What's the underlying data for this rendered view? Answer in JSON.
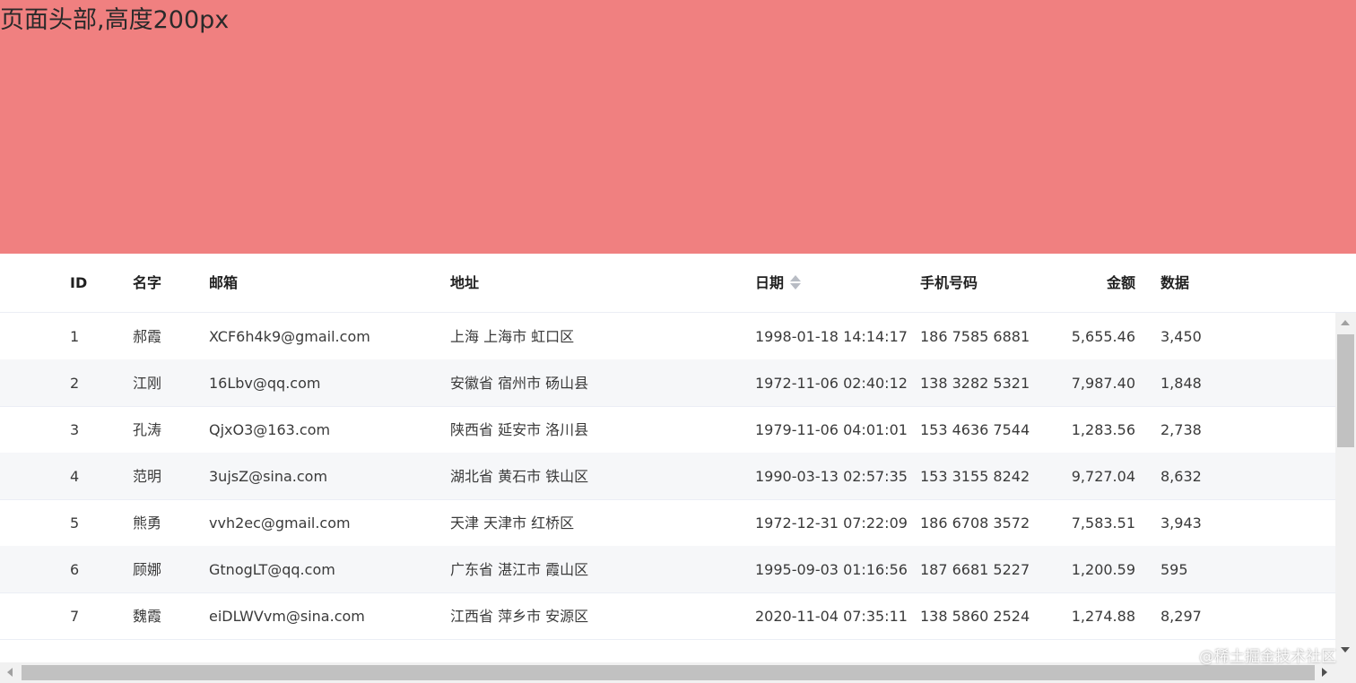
{
  "header": {
    "title": "页面头部,高度200px",
    "background": "#f08080"
  },
  "table": {
    "columns": {
      "id": "ID",
      "name": "名字",
      "email": "邮箱",
      "address": "地址",
      "date": "日期",
      "phone": "手机号码",
      "amount": "金额",
      "data": "数据"
    },
    "rows": [
      {
        "id": "1",
        "name": "郝霞",
        "email": "XCF6h4k9@gmail.com",
        "address": "上海 上海市 虹口区",
        "date": "1998-01-18 14:14:17",
        "phone": "186 7585 6881",
        "amount": "5,655.46",
        "data": "3,450"
      },
      {
        "id": "2",
        "name": "江刚",
        "email": "16Lbv@qq.com",
        "address": "安徽省 宿州市 砀山县",
        "date": "1972-11-06 02:40:12",
        "phone": "138 3282 5321",
        "amount": "7,987.40",
        "data": "1,848"
      },
      {
        "id": "3",
        "name": "孔涛",
        "email": "QjxO3@163.com",
        "address": "陕西省 延安市 洛川县",
        "date": "1979-11-06 04:01:01",
        "phone": "153 4636 7544",
        "amount": "1,283.56",
        "data": "2,738"
      },
      {
        "id": "4",
        "name": "范明",
        "email": "3ujsZ@sina.com",
        "address": "湖北省 黄石市 铁山区",
        "date": "1990-03-13 02:57:35",
        "phone": "153 3155 8242",
        "amount": "9,727.04",
        "data": "8,632"
      },
      {
        "id": "5",
        "name": "熊勇",
        "email": "vvh2ec@gmail.com",
        "address": "天津 天津市 红桥区",
        "date": "1972-12-31 07:22:09",
        "phone": "186 6708 3572",
        "amount": "7,583.51",
        "data": "3,943"
      },
      {
        "id": "6",
        "name": "顾娜",
        "email": "GtnogLT@qq.com",
        "address": "广东省 湛江市 霞山区",
        "date": "1995-09-03 01:16:56",
        "phone": "187 6681 5227",
        "amount": "1,200.59",
        "data": "595"
      },
      {
        "id": "7",
        "name": "魏霞",
        "email": "eiDLWVvm@sina.com",
        "address": "江西省 萍乡市 安源区",
        "date": "2020-11-04 07:35:11",
        "phone": "138 5860 2524",
        "amount": "1,274.88",
        "data": "8,297"
      }
    ]
  },
  "watermark": "@稀土掘金技术社区",
  "icons": {
    "sort": "sort-caret-icon",
    "scroll_up": "scroll-up-arrow-icon",
    "scroll_down": "scroll-down-arrow-icon",
    "scroll_left": "scroll-left-arrow-icon",
    "scroll_right": "scroll-right-arrow-icon"
  },
  "colors": {
    "header_bg": "#f08080",
    "stripe": "#f6f7f9",
    "border": "#ebeef5",
    "sort_icon": "#b8bcc4"
  }
}
